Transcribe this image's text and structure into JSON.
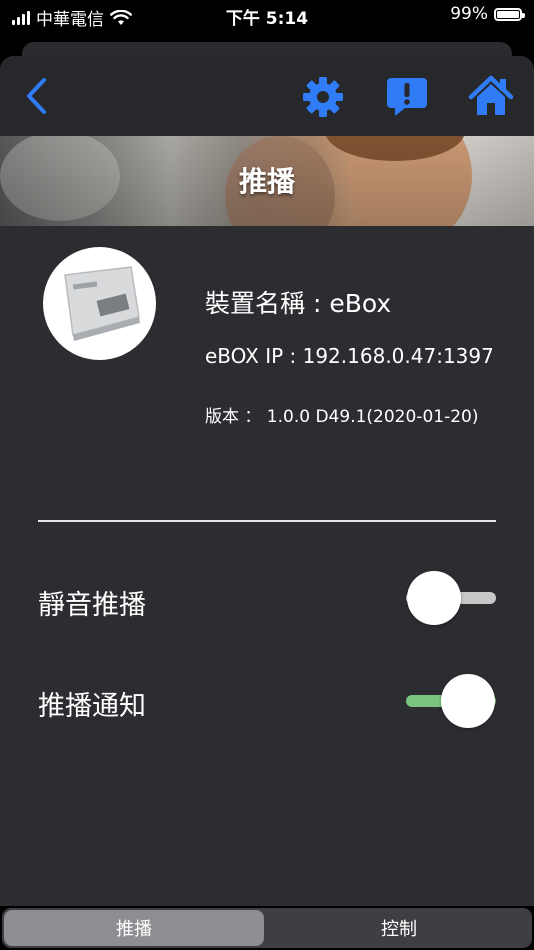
{
  "status_bar": {
    "carrier": "中華電信",
    "time": "下午 5:14",
    "battery": "99%"
  },
  "nav": {
    "back_icon": "chevron-left-icon",
    "settings_icon": "gear-icon",
    "message_icon": "alert-message-icon",
    "home_icon": "home-icon",
    "icon_color": "#2f7cf6"
  },
  "banner": {
    "title": "推播"
  },
  "device": {
    "name": "裝置名稱 : eBox",
    "ip": "eBOX IP : 192.168.0.47:1397",
    "version": "版本 ： 1.0.0 D49.1(2020-01-20)"
  },
  "settings": [
    {
      "label": "靜音推播",
      "on": false
    },
    {
      "label": "推播通知",
      "on": true
    }
  ],
  "colors": {
    "toggle_on": "#7bc47f",
    "toggle_off": "#c8c8c8"
  },
  "tabs": [
    {
      "label": "推播",
      "selected": true
    },
    {
      "label": "控制",
      "selected": false
    }
  ]
}
